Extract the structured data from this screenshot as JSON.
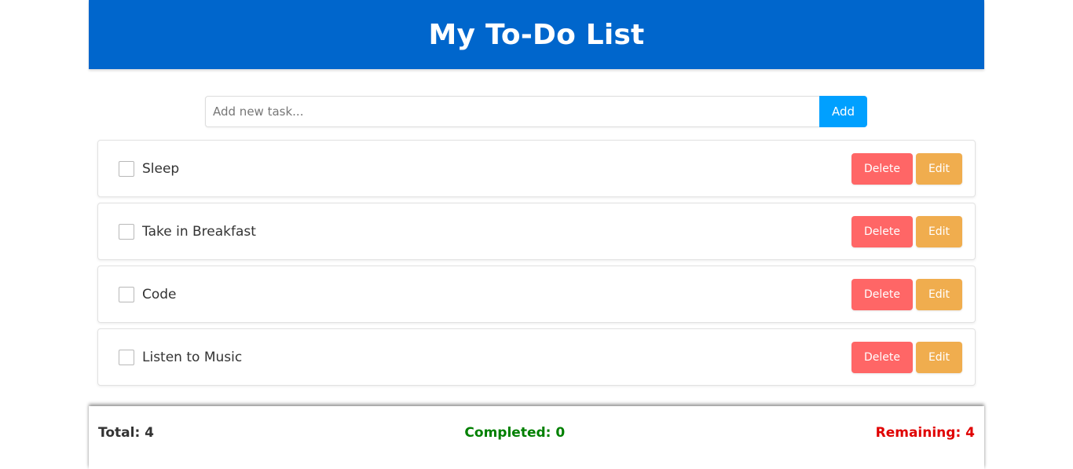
{
  "header": {
    "title": "My To-Do List",
    "background": "#0066cc"
  },
  "add_task": {
    "placeholder": "Add new task...",
    "value": "",
    "button_label": "Add"
  },
  "tasks": [
    {
      "label": "Sleep",
      "done": false,
      "delete_label": "Delete",
      "edit_label": "Edit"
    },
    {
      "label": "Take in Breakfast",
      "done": false,
      "delete_label": "Delete",
      "edit_label": "Edit"
    },
    {
      "label": "Code",
      "done": false,
      "delete_label": "Delete",
      "edit_label": "Edit"
    },
    {
      "label": "Listen to Music",
      "done": false,
      "delete_label": "Delete",
      "edit_label": "Edit"
    }
  ],
  "footer": {
    "total": "Total: 4",
    "completed": "Completed: 0",
    "remaining": "Remaining: 4"
  },
  "colors": {
    "add_button": "#00a0ff",
    "delete_button": "#ff6666",
    "edit_button": "#f0ad4e",
    "total_text": "#333333",
    "completed_text": "#008000",
    "remaining_text": "#e00000"
  }
}
